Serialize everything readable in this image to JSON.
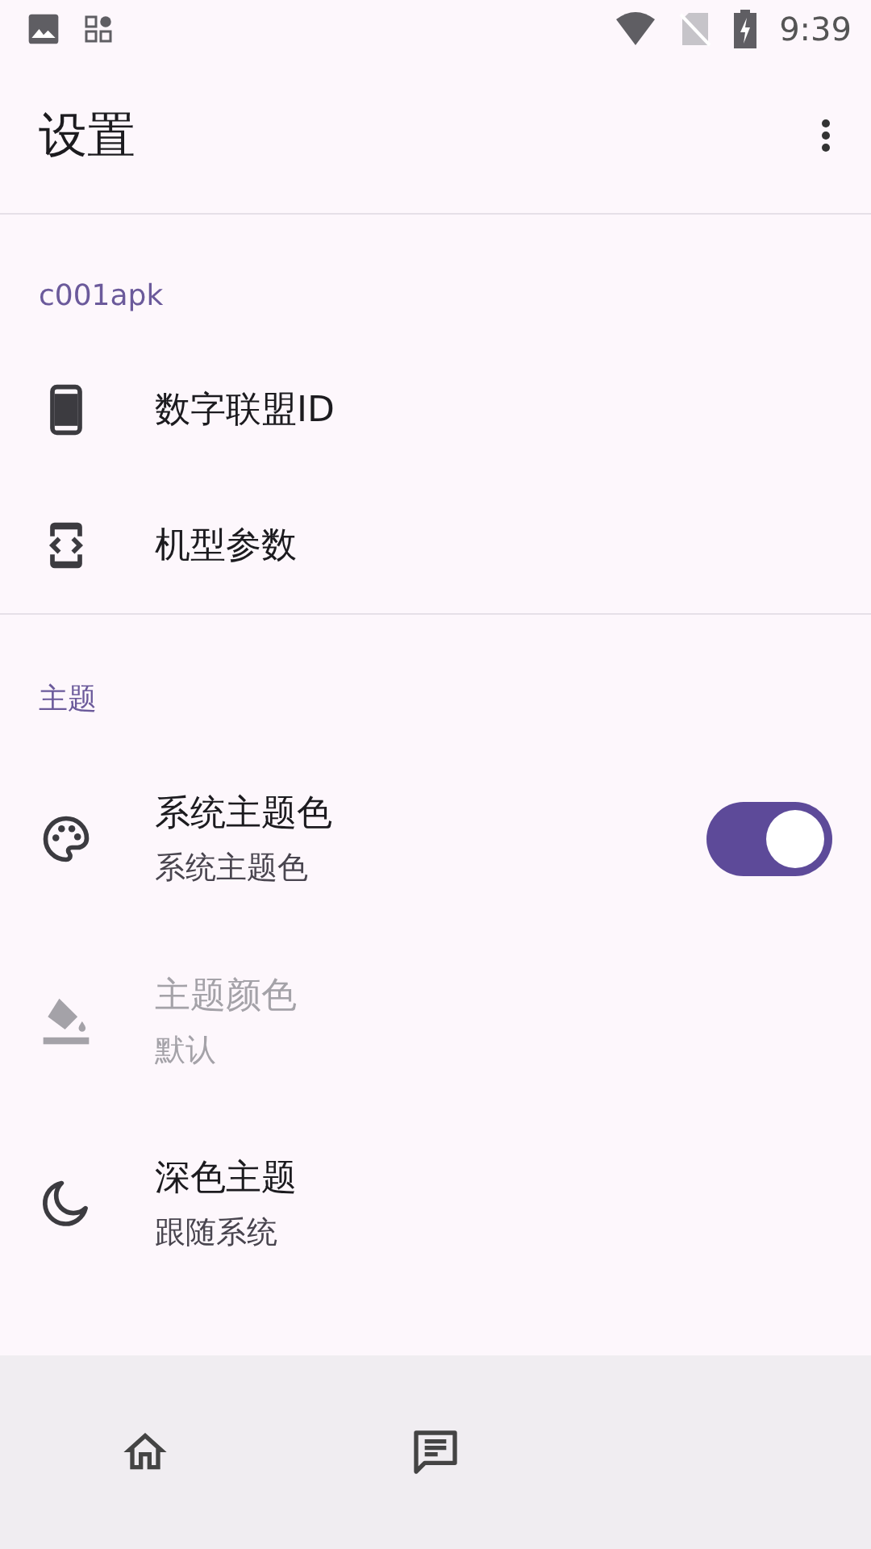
{
  "status_bar": {
    "time": "9:39"
  },
  "toolbar": {
    "title": "设置"
  },
  "sections": [
    {
      "header": "c001apk",
      "items": [
        {
          "kind": "link",
          "title": "数字联盟ID",
          "disabled": false
        },
        {
          "kind": "link",
          "title": "机型参数",
          "disabled": false
        }
      ]
    },
    {
      "header": "主题",
      "items": [
        {
          "kind": "switch",
          "title": "系统主题色",
          "summary": "系统主题色",
          "on": true,
          "disabled": false
        },
        {
          "kind": "link",
          "title": "主题颜色",
          "summary": "默认",
          "disabled": true
        },
        {
          "kind": "link",
          "title": "深色主题",
          "summary": "跟随系统",
          "disabled": false
        }
      ]
    }
  ]
}
